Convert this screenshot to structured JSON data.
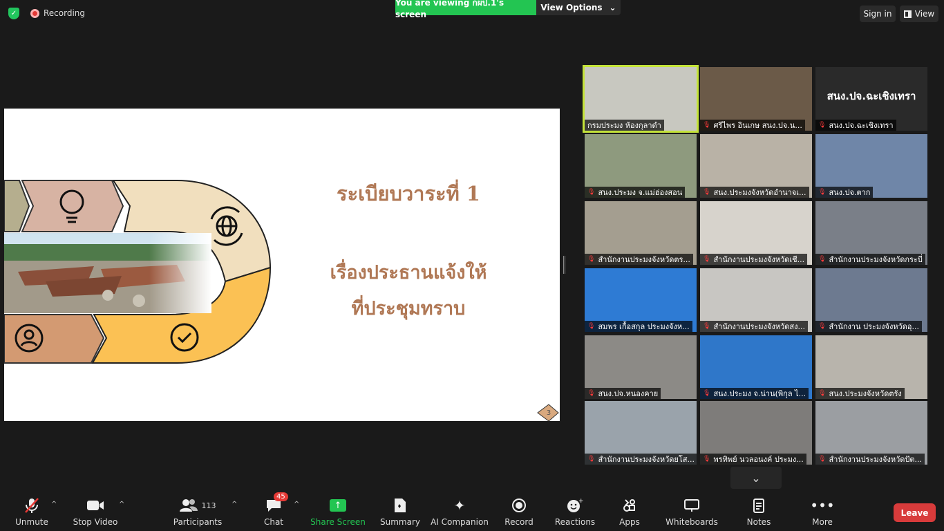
{
  "topbar": {
    "recording_label": "Recording",
    "viewing_label": "You are viewing กผป.1's screen",
    "view_options_label": "View Options",
    "signin_label": "Sign in",
    "view_label": "View"
  },
  "slide": {
    "title": "ระเบียบวาระที่ 1",
    "subtitle_line1": "เรื่องประธานแจ้งให้",
    "subtitle_line2": "ที่ประชุมทราบ",
    "page_number": "3"
  },
  "participants": [
    {
      "name": "กรมประมง ห้องกุลาดำ",
      "muted": false
    },
    {
      "name": "ศรีไพร อินเกษ สนง.ปจ.น...",
      "muted": true
    },
    {
      "name": "สนง.ปจ.ฉะเชิงเทรา",
      "muted": true,
      "logo_text": "สนง.ปจ.ฉะเชิงเทรา"
    },
    {
      "name": "สนง.ประมง จ.แม่ฮ่องสอน",
      "muted": true
    },
    {
      "name": "สนง.ประมงจังหวัดอำนาจเ...",
      "muted": true
    },
    {
      "name": "สนง.ปจ.ตาก",
      "muted": true
    },
    {
      "name": "สำนักงานประมงจังหวัดตร...",
      "muted": true
    },
    {
      "name": "สำนักงานประมงจังหวัดเชี...",
      "muted": true
    },
    {
      "name": "สำนักงานประมงจังหวัดกระบี่",
      "muted": true
    },
    {
      "name": "สมพร เกื้อสกุล ประมงจังห...",
      "muted": true
    },
    {
      "name": "สำนักงานประมงจังหวัดสง...",
      "muted": true
    },
    {
      "name": "สำนักงาน ประมงจังหวัดอุ...",
      "muted": true
    },
    {
      "name": "สนง.ปจ.หนองคาย",
      "muted": true
    },
    {
      "name": "สนง.ประมง จ.น่าน(พิกุล ไ...",
      "muted": true
    },
    {
      "name": "สนง.ประมงจังหวัดตรัง",
      "muted": true
    },
    {
      "name": "สำนักงานประมงจังหวัดยโส...",
      "muted": true
    },
    {
      "name": "พรทิพย์ นวลอนงค์ ประมง...",
      "muted": true
    },
    {
      "name": "สำนักงานประมงจังหวัดปัต...",
      "muted": true
    }
  ],
  "toolbar": {
    "unmute": "Unmute",
    "stop_video": "Stop Video",
    "participants": "Participants",
    "participants_count": "113",
    "chat": "Chat",
    "chat_badge": "45",
    "share_screen": "Share Screen",
    "summary": "Summary",
    "ai_companion": "AI Companion",
    "record": "Record",
    "reactions": "Reactions",
    "apps": "Apps",
    "whiteboards": "Whiteboards",
    "notes": "Notes",
    "more": "More",
    "leave": "Leave"
  }
}
